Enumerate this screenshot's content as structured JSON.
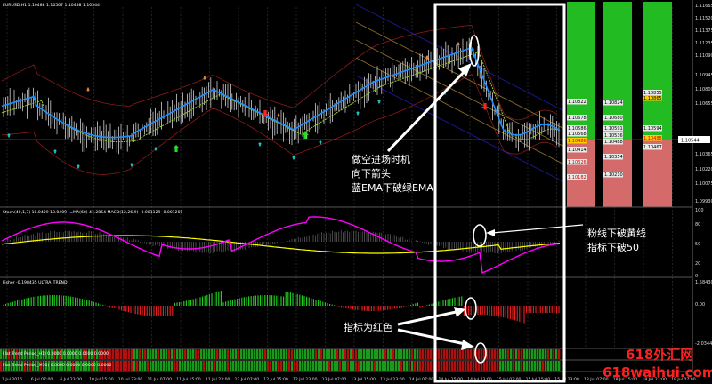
{
  "main_header": "EURUSD,H1  1.10488 1.10567 1.10488 1.10544",
  "stoch_header": "Stoch(40,1,7) 18.0409 18.0409  -=MA(60) 41.2864  MACD(12,26,9) -0.001129 -0.001201",
  "fisher_header": "Fisher -0.198435  ULTRA_TREND",
  "flat1_header": "Flat Trend Period_H1) 0.0000 0.0000 0.0000 0.0000",
  "flat2_header": "Flat Trend Period_M30) 0.0000 0.0000 0.0000 0.0000",
  "price_axis": [
    "1.11665",
    "1.11520",
    "1.11375",
    "1.11235",
    "1.11090",
    "1.10945",
    "1.10800",
    "1.10655",
    "1.10544",
    "1.10365",
    "1.10220",
    "1.10075",
    "1.09930"
  ],
  "current_price": "1.10544",
  "stoch_axis": [
    "100",
    "80",
    "50",
    "20",
    "0"
  ],
  "fisher_axis": [
    "1.584305",
    "0.00",
    "-2.034460"
  ],
  "time_axis": [
    "1 Jul 2016",
    "6 Jul 07:00",
    "6 Jul 23:00",
    "10 Jul 15:00",
    "10 Jul 23:00",
    "11 Jul 07:00",
    "11 Jul 15:00",
    "11 Jul 23:00",
    "12 Jul 07:00",
    "12 Jul 15:00",
    "12 Jul 23:00",
    "13 Jul 07:00",
    "13 Jul 15:00",
    "13 Jul 23:00",
    "14 Jul 07:00",
    "14 Jul 15:00",
    "14 Jul 23:00",
    "15 Jul 07:00",
    "15 Jul 15:00",
    "15 Jul 23:00",
    "18 Jul 07:00",
    "18 Jul 15:00",
    "18 Jul 23:00",
    "19 Jul 07:00"
  ],
  "level_columns": [
    {
      "levels": [
        {
          "text": "1.10822",
          "bg": "#e8e8e8",
          "color": "#000000"
        },
        {
          "text": "1.10678",
          "bg": "#e8e8e8",
          "color": "#000000"
        },
        {
          "text": "1.10586",
          "bg": "#e8e8e8",
          "color": "#000000"
        },
        {
          "text": "1.10568",
          "bg": "#e8e8e8",
          "color": "#000000"
        },
        {
          "text": "1.10486",
          "bg": "#ffcc00",
          "color": "#cc0000"
        },
        {
          "text": "1.10414",
          "bg": "#e8e8e8",
          "color": "#000000"
        },
        {
          "text": "1.10326",
          "bg": "#e8e8e8",
          "color": "#cc0000"
        },
        {
          "text": "1.10182",
          "bg": "#e8e8e8",
          "color": "#cc0000"
        }
      ]
    },
    {
      "levels": [
        {
          "text": "1.10824",
          "bg": "#e8e8e8",
          "color": "#000000"
        },
        {
          "text": "1.10680",
          "bg": "#e8e8e8",
          "color": "#000000"
        },
        {
          "text": "1.10591",
          "bg": "#e8e8e8",
          "color": "#000000"
        },
        {
          "text": "1.10536",
          "bg": "#e8e8e8",
          "color": "#000000"
        },
        {
          "text": "1.10488",
          "bg": "#e8e8e8",
          "color": "#000000"
        },
        {
          "text": "1.10354",
          "bg": "#e8e8e8",
          "color": "#000000"
        },
        {
          "text": "1.10210",
          "bg": "#e8e8e8",
          "color": "#000000"
        }
      ]
    },
    {
      "levels": [
        {
          "text": "1.10855",
          "bg": "#e8e8e8",
          "color": "#000000"
        },
        {
          "text": "1.10865",
          "bg": "#ffcc00",
          "color": "#000000"
        },
        {
          "text": "1.10594",
          "bg": "#e8e8e8",
          "color": "#000000"
        },
        {
          "text": "1.10488",
          "bg": "#ffcc00",
          "color": "#cc0000"
        },
        {
          "text": "1.10467",
          "bg": "#e8e8e8",
          "color": "#000000"
        }
      ]
    }
  ],
  "annotations": {
    "entry": [
      "做空进场时机",
      "向下箭头",
      "蓝EMA下破绿EMA"
    ],
    "stoch": [
      "粉线下破黄线",
      "指标下破50"
    ],
    "fisher": "指标为红色"
  },
  "watermark": {
    "line1": "618外汇网",
    "line2": "618waihui.com"
  },
  "colors": {
    "bg": "#000000",
    "candles": "#d0d0d0",
    "ema_blue": "#1e90ff",
    "ema_green": "#9acd32",
    "bands": "#8b1a1a",
    "stoch_main": "#ff00ff",
    "stoch_signal": "#ffff00",
    "fisher_up": "#1ec81e",
    "fisher_down": "#e02020",
    "level_up": "#22bb22",
    "level_down": "#d46a6a"
  }
}
